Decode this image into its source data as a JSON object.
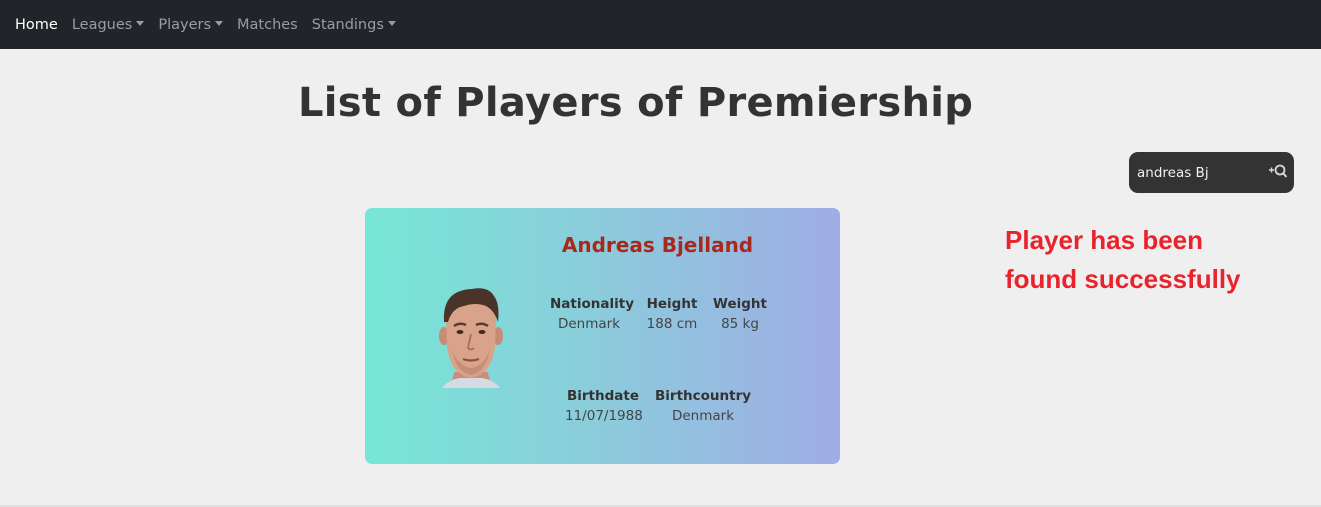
{
  "nav": {
    "items": [
      {
        "label": "Home",
        "dropdown": false
      },
      {
        "label": "Leagues",
        "dropdown": true
      },
      {
        "label": "Players",
        "dropdown": true
      },
      {
        "label": "Matches",
        "dropdown": false
      },
      {
        "label": "Standings",
        "dropdown": true
      }
    ]
  },
  "page": {
    "title": "List of Players of Premiership"
  },
  "search": {
    "value": "andreas Bj",
    "icon": "add-search-icon"
  },
  "player": {
    "name": "Andreas Bjelland",
    "photo_icon": "player-photo",
    "stats": {
      "nationality": {
        "label": "Nationality",
        "value": "Denmark"
      },
      "height": {
        "label": "Height",
        "value": "188 cm"
      },
      "weight": {
        "label": "Weight",
        "value": "85 kg"
      },
      "birthdate": {
        "label": "Birthdate",
        "value": "11/07/1988"
      },
      "birthcountry": {
        "label": "Birthcountry",
        "value": "Denmark"
      }
    }
  },
  "notice": {
    "line1": "Player has been",
    "line2": "found successfully",
    "color": "#e8232b"
  },
  "colors": {
    "navbar": "#212529",
    "card_gradient_start": "#76e7d6",
    "card_gradient_end": "#a0ace6",
    "player_name": "#a8281c"
  }
}
